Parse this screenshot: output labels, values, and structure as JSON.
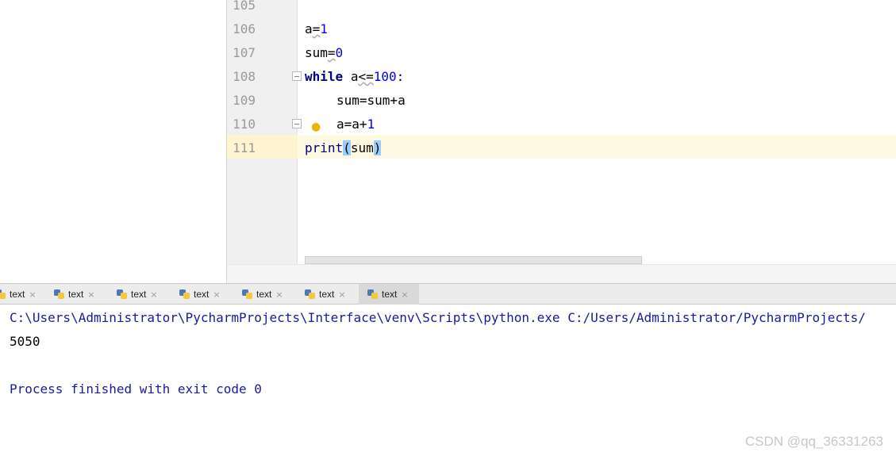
{
  "editor": {
    "lines": [
      {
        "no": "105"
      },
      {
        "no": "106"
      },
      {
        "no": "107"
      },
      {
        "no": "108"
      },
      {
        "no": "109"
      },
      {
        "no": "110"
      },
      {
        "no": "111"
      }
    ],
    "code": {
      "l106_var": "a",
      "l106_op": "=",
      "l106_val": "1",
      "l107_var": "sum",
      "l107_op": "=",
      "l107_val": "0",
      "l108_kw": "while",
      "l108_var": "a",
      "l108_op": "<=",
      "l108_val": "100",
      "l108_colon": ":",
      "l109_text": "sum=sum+a",
      "l110_text": "a=a+",
      "l110_val": "1",
      "l111_fn": "print",
      "l111_open": "(",
      "l111_arg": "sum",
      "l111_close": ")"
    },
    "highlight_color": "#fffae3",
    "bracket_match_color": "#99ccff"
  },
  "tabs": [
    {
      "label": "text",
      "close": "×"
    },
    {
      "label": "text",
      "close": "×"
    },
    {
      "label": "text",
      "close": "×"
    },
    {
      "label": "text",
      "close": "×"
    },
    {
      "label": "text",
      "close": "×"
    },
    {
      "label": "text",
      "close": "×"
    },
    {
      "label": "text",
      "close": "×",
      "active": true
    }
  ],
  "console": {
    "command": "C:\\Users\\Administrator\\PycharmProjects\\Interface\\venv\\Scripts\\python.exe C:/Users/Administrator/PycharmProjects/",
    "output": "5050",
    "finish": "Process finished with exit code 0"
  },
  "watermark": "CSDN @qq_36331263",
  "icons": {
    "tab_icon": "python-file-icon",
    "bulb": "lightbulb-icon"
  }
}
